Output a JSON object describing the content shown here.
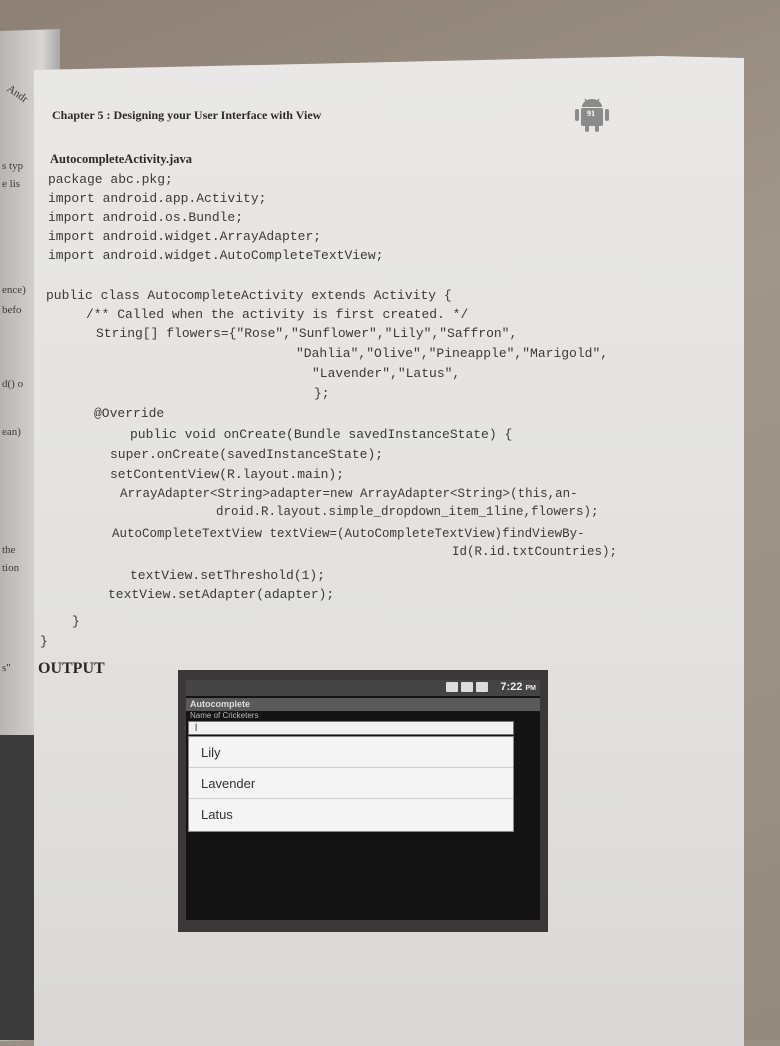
{
  "page": {
    "chapter_header": "Chapter 5 : Designing your User Interface with View",
    "page_number": "91",
    "file_title": "AutocompleteActivity.java",
    "imports": [
      "package abc.pkg;",
      "import android.app.Activity;",
      "import android.os.Bundle;",
      "import android.widget.ArrayAdapter;",
      "import android.widget.AutoCompleteTextView;"
    ],
    "code": {
      "l01": "public class AutocompleteActivity extends Activity {",
      "l02": "/** Called when the activity is first created. */",
      "l03": "String[] flowers={\"Rose\",\"Sunflower\",\"Lily\",\"Saffron\",",
      "l04": "\"Dahlia\",\"Olive\",\"Pineapple\",\"Marigold\",",
      "l05": "\"Lavender\",\"Latus\",",
      "l06": "};",
      "l07": "@Override",
      "l08": "public void onCreate(Bundle savedInstanceState) {",
      "l09": "super.onCreate(savedInstanceState);",
      "l10": "setContentView(R.layout.main);",
      "l11": "ArrayAdapter<String>adapter=new ArrayAdapter<String>(this,an-",
      "l12": "droid.R.layout.simple_dropdown_item_1line,flowers);",
      "l13": "AutoCompleteTextView textView=(AutoCompleteTextView)findViewBy-",
      "l14": "Id(R.id.txtCountries);",
      "l15": "textView.setThreshold(1);",
      "l16": "textView.setAdapter(adapter);",
      "l17": "}",
      "l18": "}"
    },
    "output_label": "OUTPUT"
  },
  "screenshot": {
    "time": "7:22",
    "time_suffix": "PM",
    "app_title": "Autocomplete",
    "field_hint": "Name of Cricketers",
    "input_value": "l",
    "suggestions": [
      "Lily",
      "Lavender",
      "Latus"
    ]
  },
  "left_page_fragments": [
    "Andr",
    "s typ",
    "e lis",
    "ence)",
    "befo",
    "d() o",
    "ean)",
    "the",
    "tion",
    "s\""
  ]
}
